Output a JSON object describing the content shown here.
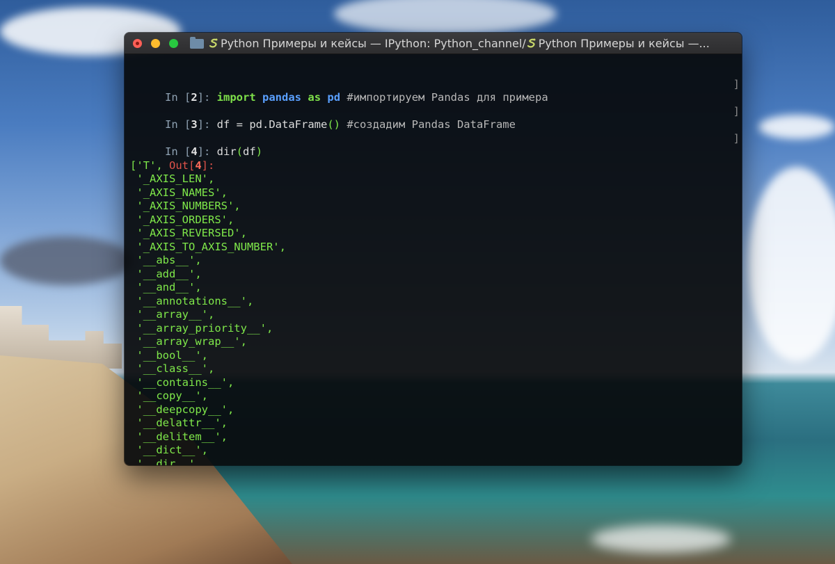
{
  "window": {
    "title": "Python Примеры и кейсы — IPython: Python_channel/",
    "title_tail": "Python Примеры и кейсы —..."
  },
  "cells": [
    {
      "prompt_in": "In [",
      "num": "2",
      "prompt_close": "]: ",
      "parts": [
        {
          "t": "import",
          "c": "kw"
        },
        {
          "t": " ",
          "c": "code"
        },
        {
          "t": "pandas",
          "c": "mod"
        },
        {
          "t": " ",
          "c": "code"
        },
        {
          "t": "as",
          "c": "kw"
        },
        {
          "t": " ",
          "c": "code"
        },
        {
          "t": "pd",
          "c": "mod"
        },
        {
          "t": " #импортируем Pandas для примера",
          "c": "comment"
        }
      ]
    },
    {
      "prompt_in": "In [",
      "num": "3",
      "prompt_close": "]: ",
      "parts": [
        {
          "t": "df = pd.DataFrame",
          "c": "code"
        },
        {
          "t": "()",
          "c": "paren"
        },
        {
          "t": " #создадим Pandas DataFrame",
          "c": "comment"
        }
      ]
    },
    {
      "prompt_in": "In [",
      "num": "4",
      "prompt_close": "]: ",
      "parts": [
        {
          "t": "dir",
          "c": "code"
        },
        {
          "t": "(",
          "c": "paren"
        },
        {
          "t": "df",
          "c": "code"
        },
        {
          "t": ")",
          "c": "paren"
        }
      ]
    }
  ],
  "output": {
    "prompt": "Out[",
    "num": "4",
    "prompt_close": "]:",
    "lines": [
      "['T',",
      " '_AXIS_LEN',",
      " '_AXIS_NAMES',",
      " '_AXIS_NUMBERS',",
      " '_AXIS_ORDERS',",
      " '_AXIS_REVERSED',",
      " '_AXIS_TO_AXIS_NUMBER',",
      " '__abs__',",
      " '__add__',",
      " '__and__',",
      " '__annotations__',",
      " '__array__',",
      " '__array_priority__',",
      " '__array_wrap__',",
      " '__bool__',",
      " '__class__',",
      " '__contains__',",
      " '__copy__',",
      " '__deepcopy__',",
      " '__delattr__',",
      " '__delitem__',",
      " '__dict__',",
      " '__dir__',"
    ]
  },
  "right_bracket": "]"
}
